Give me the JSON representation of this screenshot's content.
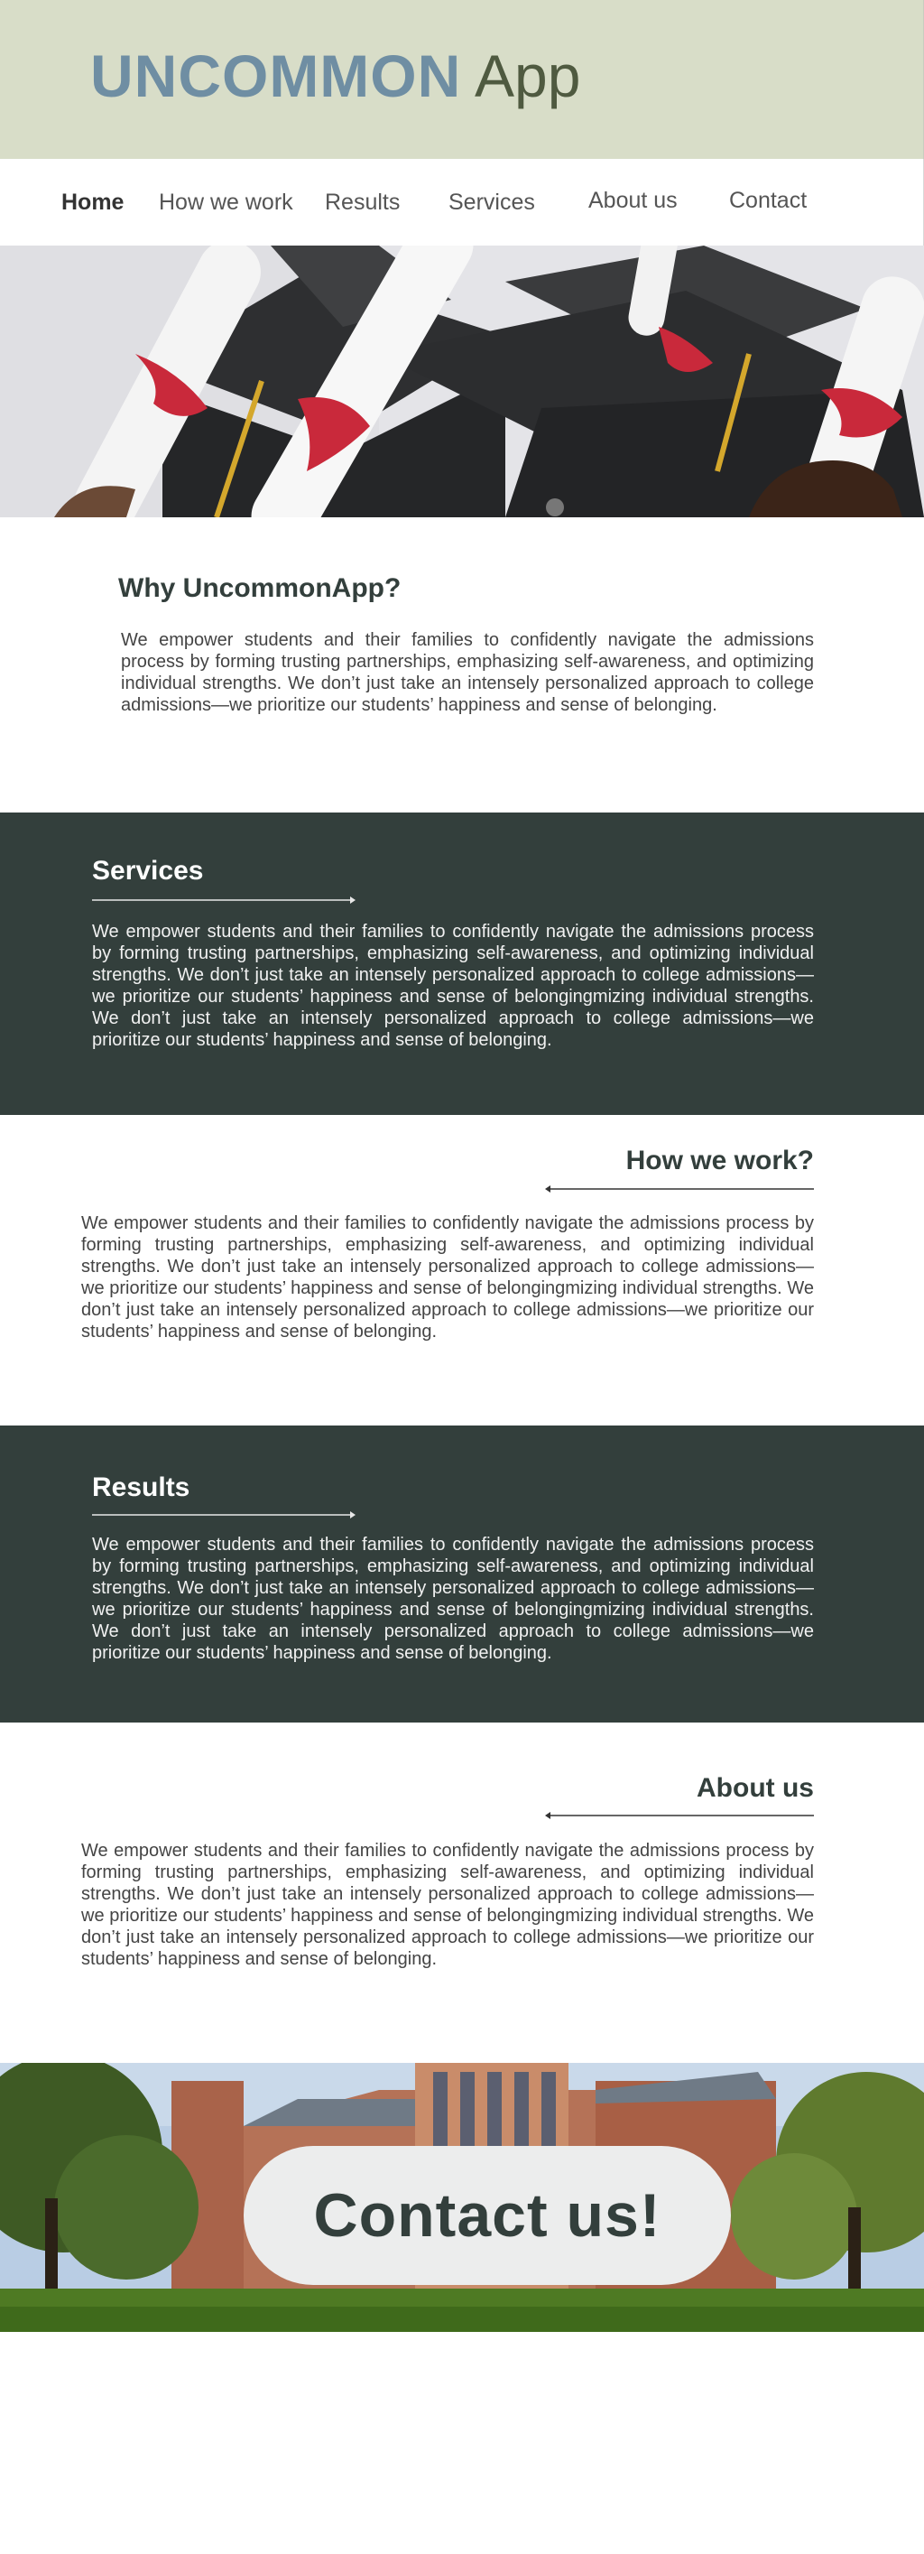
{
  "header": {
    "logo_strong": "UNCOMMON",
    "logo_light": "App"
  },
  "nav": {
    "items": [
      {
        "label": "Home"
      },
      {
        "label": "How we work"
      },
      {
        "label": "Results"
      },
      {
        "label": "Services"
      },
      {
        "label": "About us"
      },
      {
        "label": "Contact"
      }
    ]
  },
  "why": {
    "title": "Why UncommonApp?",
    "text": "We empower students and their families to confidently navigate the admissions process by forming trusting partnerships, emphasizing self-awareness, and optimizing individual strengths. We don’t just take an intensely personalized approach to college admissions—we prioritize our students’ happiness and sense of belonging."
  },
  "services": {
    "title": "Services",
    "text": "We empower students and their families to confidently navigate the admissions process by forming trusting partnerships, emphasizing self-awareness, and optimizing individual strengths. We don’t just take an intensely personalized approach to college admissions—we prioritize our students’ happiness and sense of belongingmizing individual strengths. We don’t just take an intensely personalized approach to college admissions—we prioritize our students’ happiness and sense of belonging."
  },
  "how": {
    "title": "How we work?",
    "text": "We empower students and their families to confidently navigate the admissions process by forming trusting partnerships, emphasizing self-awareness, and optimizing individual strengths. We don’t just take an intensely personalized approach to college admissions—we prioritize our students’ happiness and sense of belongingmizing individual strengths. We don’t just take an intensely personalized approach to college admissions—we prioritize our students’ happiness and sense of belonging."
  },
  "results": {
    "title": "Results",
    "text": "We empower students and their families to confidently navigate the admissions process by forming trusting partnerships, emphasizing self-awareness, and optimizing individual strengths. We don’t just take an intensely personalized approach to college admissions—we prioritize our students’ happiness and sense of belongingmizing individual strengths. We don’t just take an intensely personalized approach to college admissions—we prioritize our students’ happiness and sense of belonging."
  },
  "about": {
    "title": "About us",
    "text": "We empower students and their families to confidently navigate the admissions process by forming trusting partnerships, emphasizing self-awareness, and optimizing individual strengths. We don’t just take an intensely personalized approach to college admissions—we prioritize our students’ happiness and sense of belongingmizing individual strengths. We don’t just take an intensely personalized approach to college admissions—we prioritize our students’ happiness and sense of belonging."
  },
  "contact": {
    "label": "Contact us!"
  },
  "colors": {
    "header_bg": "#d8ddc8",
    "logo_blue": "#6f8ea3",
    "logo_olive": "#4f5a40",
    "dark_section": "#333f3c",
    "accent_red": "#c9293b",
    "accent_gold": "#d4a72c"
  }
}
